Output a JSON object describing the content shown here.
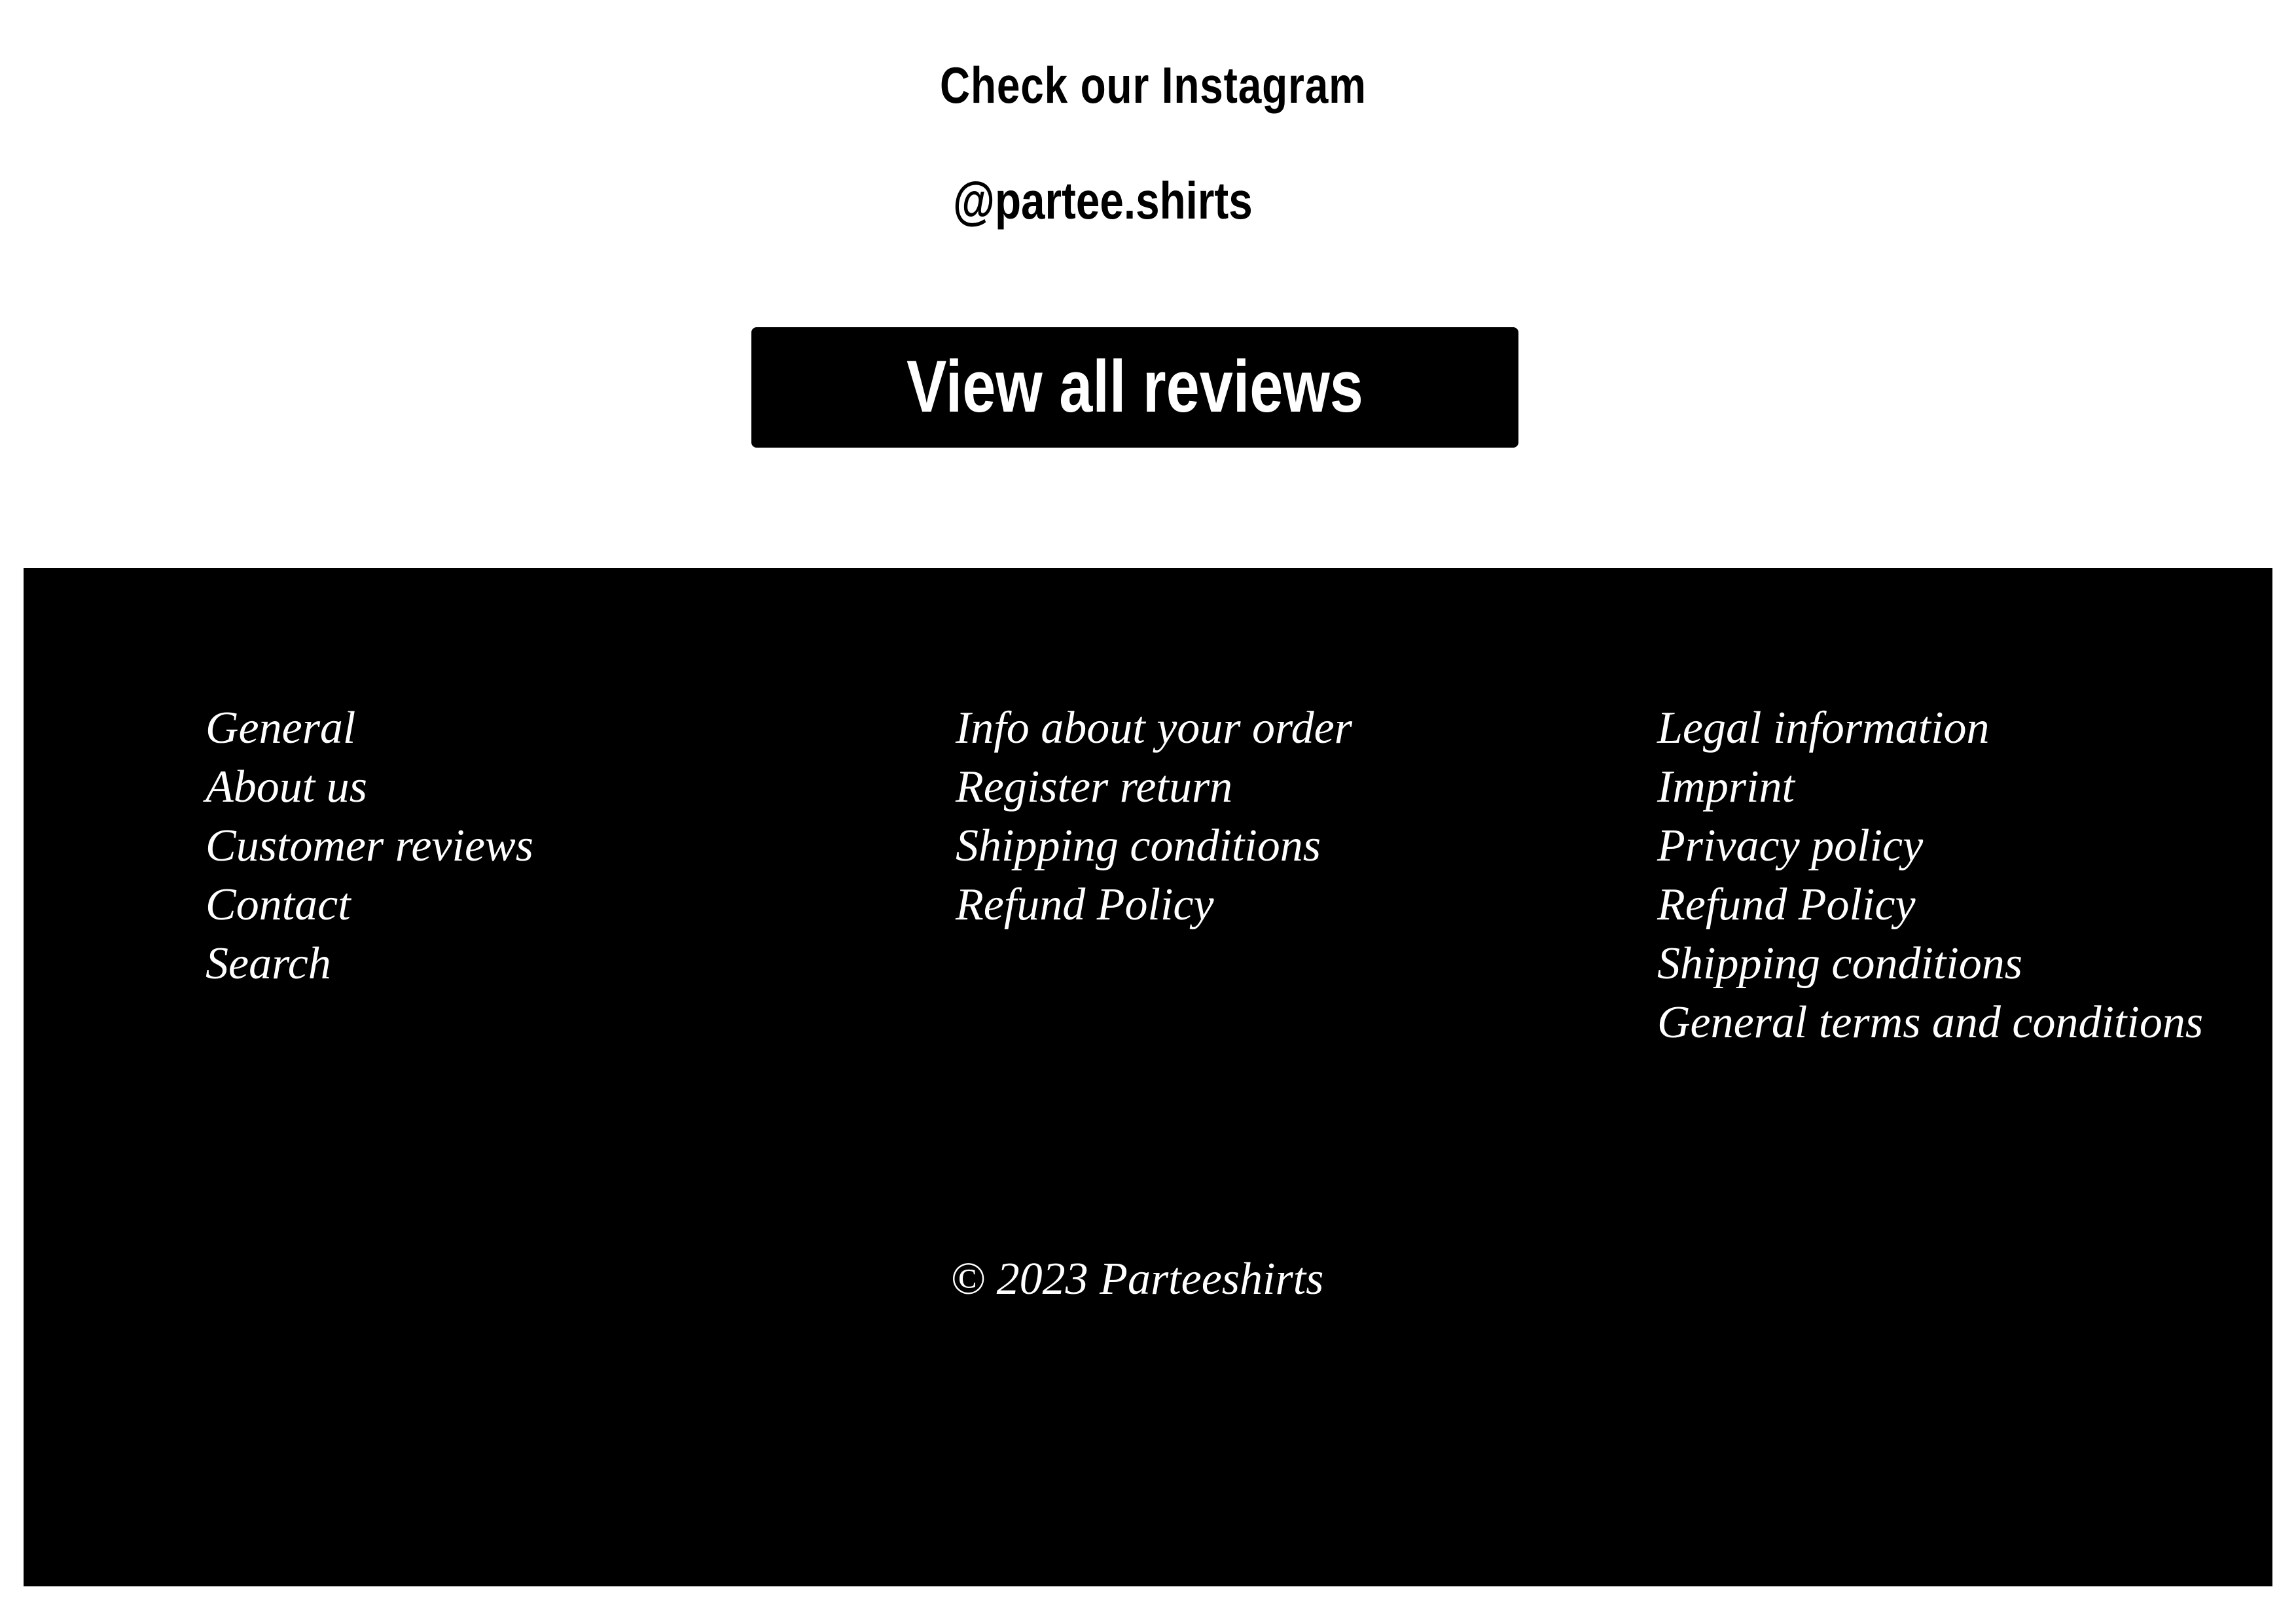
{
  "instagram": {
    "heading": "Check our Instagram",
    "handle": "@partee.shirts"
  },
  "reviews_button": {
    "label": "View all reviews"
  },
  "footer": {
    "background": "#000000",
    "text_color": "#ffffff",
    "columns": [
      {
        "heading": "General",
        "links": [
          "About us",
          "Customer reviews",
          "Contact",
          "Search"
        ]
      },
      {
        "heading": "Info about your order",
        "links": [
          "Register return",
          "Shipping conditions",
          "Refund Policy"
        ]
      },
      {
        "heading": "Legal information",
        "links": [
          "Imprint",
          "Privacy policy",
          "Refund Policy",
          "Shipping conditions",
          "General terms and conditions"
        ]
      }
    ],
    "copyright": "© 2023 Parteeshirts"
  }
}
